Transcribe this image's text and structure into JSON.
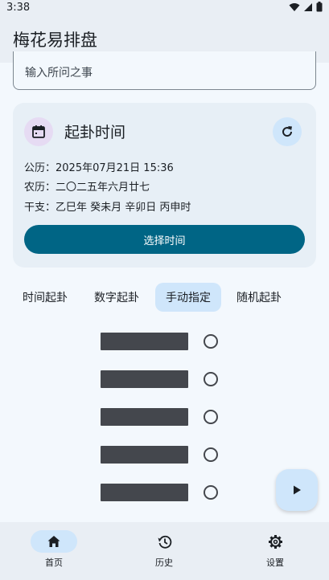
{
  "status_bar": {
    "time": "3:38",
    "icons": [
      "wifi-icon",
      "signal-icon",
      "battery-icon"
    ]
  },
  "app": {
    "title": "梅花易排盘"
  },
  "question": {
    "placeholder": "输入所问之事"
  },
  "time_card": {
    "title": "起卦时间",
    "icon": "calendar-icon",
    "refresh_icon": "refresh-icon",
    "gregorian": "公历：2025年07月21日 15:36",
    "lunar": "农历：二〇二五年六月廿七",
    "ganzhi": "干支：乙巳年 癸未月 辛卯日 丙申时",
    "select_button": "选择时间"
  },
  "mode_tabs": [
    {
      "label": "时间起卦",
      "selected": false
    },
    {
      "label": "数字起卦",
      "selected": false
    },
    {
      "label": "手动指定",
      "selected": true
    },
    {
      "label": "随机起卦",
      "selected": false
    }
  ],
  "yao_lines": [
    {
      "type": "yang",
      "moving": false
    },
    {
      "type": "yang",
      "moving": false
    },
    {
      "type": "yang",
      "moving": false
    },
    {
      "type": "yang",
      "moving": false
    },
    {
      "type": "yang",
      "moving": false
    }
  ],
  "fab": {
    "icon": "play-icon"
  },
  "bottom_nav": [
    {
      "label": "首页",
      "icon": "home-icon",
      "active": true
    },
    {
      "label": "历史",
      "icon": "history-icon",
      "active": false
    },
    {
      "label": "设置",
      "icon": "settings-icon",
      "active": false
    }
  ],
  "colors": {
    "background": "#f3f8fd",
    "bar": "#e9eef4",
    "card": "#e7eff6",
    "primary_button": "#006585",
    "selected_container": "#cfe6fb",
    "calendar_circle": "#e6dbf3",
    "yao_line": "#44474d"
  }
}
